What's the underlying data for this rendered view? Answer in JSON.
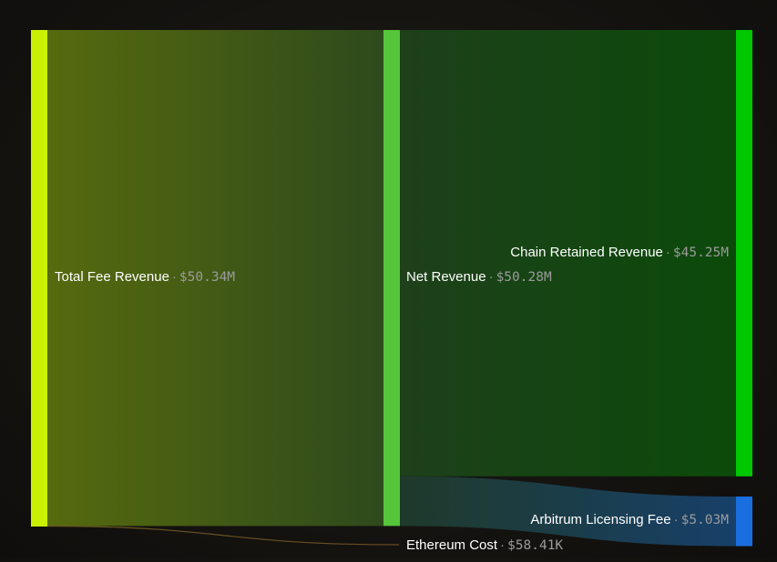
{
  "chart_data": {
    "type": "sankey",
    "nodes": [
      {
        "id": "total",
        "name": "Total Fee Revenue",
        "value": 50.34,
        "display": "$50.34M",
        "color": "#c8f000"
      },
      {
        "id": "net",
        "name": "Net Revenue",
        "value": 50.28,
        "display": "$50.28M",
        "color": "#55c53a"
      },
      {
        "id": "eth",
        "name": "Ethereum Cost",
        "value": 0.05841,
        "display": "$58.41K",
        "color": "#7a5a2a"
      },
      {
        "id": "chain",
        "name": "Chain Retained Revenue",
        "value": 45.25,
        "display": "$45.25M",
        "color": "#00c800"
      },
      {
        "id": "arb",
        "name": "Arbitrum Licensing Fee",
        "value": 5.03,
        "display": "$5.03M",
        "color": "#1a6fe0"
      }
    ],
    "links": [
      {
        "source": "total",
        "target": "net",
        "value": 50.28
      },
      {
        "source": "total",
        "target": "eth",
        "value": 0.05841
      },
      {
        "source": "net",
        "target": "chain",
        "value": 45.25
      },
      {
        "source": "net",
        "target": "arb",
        "value": 5.03
      }
    ],
    "separator": "·",
    "unit": "USD"
  }
}
